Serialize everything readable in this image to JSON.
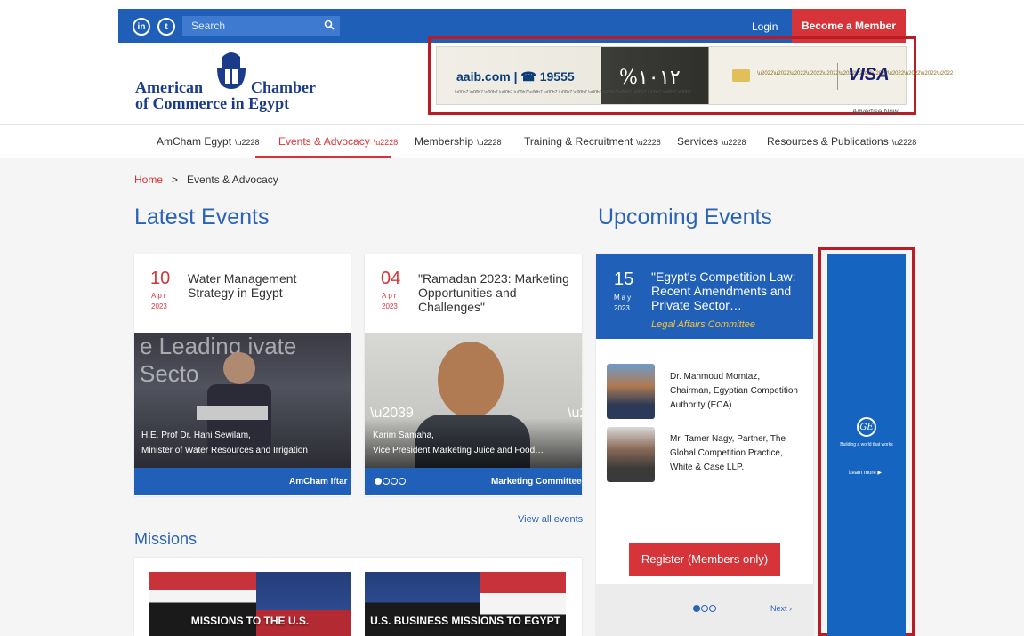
{
  "topbar": {
    "social": [
      "in",
      "t"
    ],
    "search_placeholder": "Search",
    "login": "Login",
    "become_member": "Become a Member"
  },
  "header": {
    "logo_line1a": "American",
    "logo_line1b": "Chamber",
    "logo_line2": "of Commerce in Egypt",
    "ad": {
      "aaib": "aaib.com | ☎ 19555",
      "pct1": "%١٠",
      "pct2": "١٢",
      "visa": "VISA",
      "advertise": "Advertise Now"
    }
  },
  "nav": {
    "items": [
      {
        "label": "AmCham Egypt"
      },
      {
        "label": "Events & Advocacy"
      },
      {
        "label": "Membership"
      },
      {
        "label": "Training & Recruitment"
      },
      {
        "label": "Services"
      },
      {
        "label": "Resources & Publications"
      }
    ]
  },
  "breadcrumb": {
    "home": "Home",
    "sep": ">",
    "current": "Events & Advocacy"
  },
  "sections": {
    "latest": "Latest Events",
    "upcoming": "Upcoming Events",
    "missions": "Missions",
    "view_all": "View all events"
  },
  "events": [
    {
      "day": "10",
      "month": "Apr",
      "year": "2023",
      "title": "Water Management Strategy in Egypt",
      "caption_1": "H.E. Prof Dr. Hani Sewilam,",
      "caption_2": "Minister of Water Resources and Irrigation",
      "committee": "AmCham Iftar",
      "photo_text": "e Leading ivate Secto"
    },
    {
      "day": "04",
      "month": "Apr",
      "year": "2023",
      "title": "\"Ramadan 2023: Marketing Opportunities and Challenges\"",
      "caption_1": "Karim Samaha,",
      "caption_2": "Vice President Marketing Juice and Food…",
      "committee": "Marketing Committee"
    }
  ],
  "upcoming": {
    "day": "15",
    "month": "May",
    "year": "2023",
    "title": "\"Egypt's Competition Law: Recent Amendments and Private Sector…",
    "committee": "Legal Affairs Committee",
    "speakers": [
      {
        "text": "Dr. Mahmoud Momtaz, Chairman, Egyptian Competition Authority (ECA)"
      },
      {
        "text": "Mr. Tamer Nagy, Partner, The Global Competition Practice, White & Case LLP."
      }
    ],
    "register": "Register (Members only)",
    "next": "Next ›"
  },
  "ge_ad": {
    "logo": "GE",
    "tagline": "Building a world that works",
    "learn": "Learn more ▶"
  },
  "missions": [
    {
      "label": "MISSIONS TO THE U.S."
    },
    {
      "label": "U.S. BUSINESS MISSIONS TO EGYPT"
    }
  ],
  "colors": {
    "brand_blue": "#1f5fb8",
    "accent_red": "#d73439",
    "link_blue": "#2a64b8"
  }
}
